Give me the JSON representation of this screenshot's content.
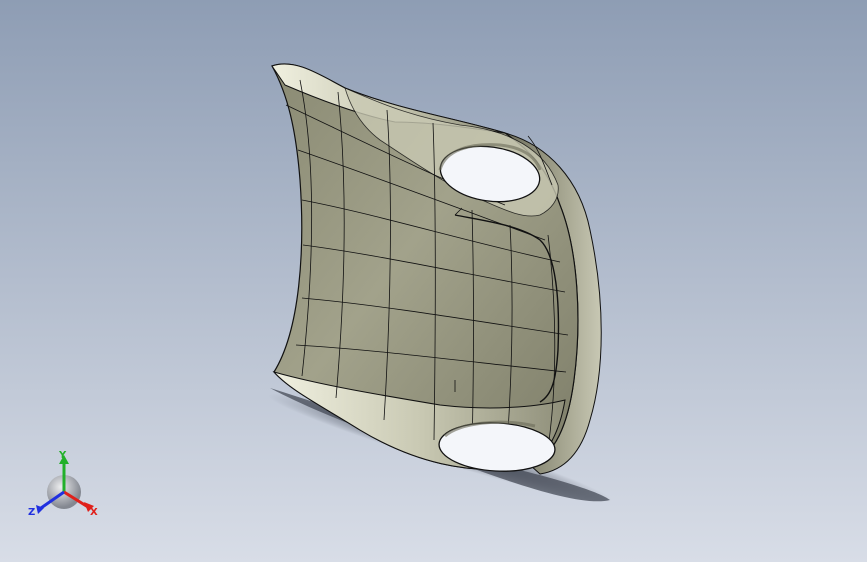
{
  "viewport": {
    "background_top": "#8e9db4",
    "background_bottom": "#d8dde7"
  },
  "model": {
    "name": "surface-panel-with-two-elliptical-openings",
    "face_color": "#9c9c86",
    "highlight_color": "#e3e3d2",
    "edge_color": "#101010",
    "hole_color": "#f4f6fa",
    "hole_count": 2
  },
  "triad": {
    "x_label": "X",
    "y_label": "Y",
    "z_label": "Z",
    "x_color": "#e0201a",
    "y_color": "#22b02a",
    "z_color": "#2030e0"
  }
}
